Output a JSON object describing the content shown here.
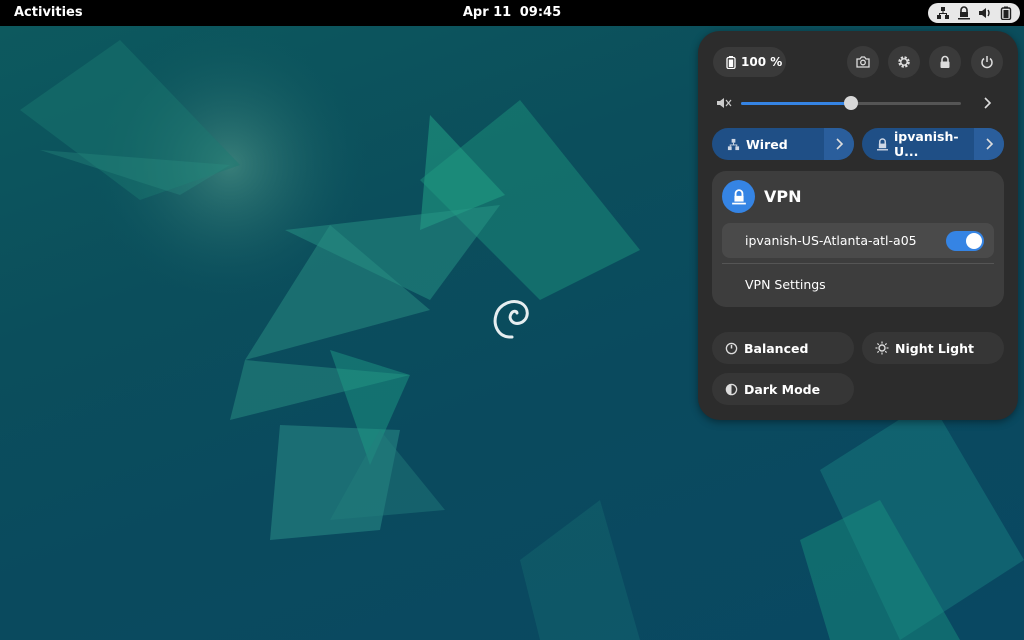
{
  "topbar": {
    "activities_label": "Activities",
    "date": "Apr 11",
    "time": "09:45",
    "tray_icons": [
      "network-wired-icon",
      "vpn-lock-icon",
      "volume-icon",
      "battery-icon"
    ]
  },
  "quick_settings": {
    "battery_label": "100 %",
    "action_icons": [
      "screenshot-icon",
      "settings-gear-icon",
      "lock-icon",
      "power-icon"
    ],
    "volume": {
      "level_fraction": 0.5,
      "muted_icon": "speaker-muted-icon"
    },
    "tiles": {
      "wired_label": "Wired",
      "vpn_tile_label": "ipvanish-U..."
    },
    "vpn_menu": {
      "title": "VPN",
      "connection_name": "ipvanish-US-Atlanta-atl-a05",
      "connection_enabled": true,
      "settings_label": "VPN Settings"
    },
    "features": {
      "power_mode_label": "Balanced",
      "night_light_label": "Night Light",
      "dark_mode_label": "Dark Mode"
    }
  },
  "colors": {
    "accent": "#3584e4",
    "tile_active": "#1f4f86",
    "panel_bg": "#2c2c2c",
    "wallpaper": "#0b4e5c"
  }
}
